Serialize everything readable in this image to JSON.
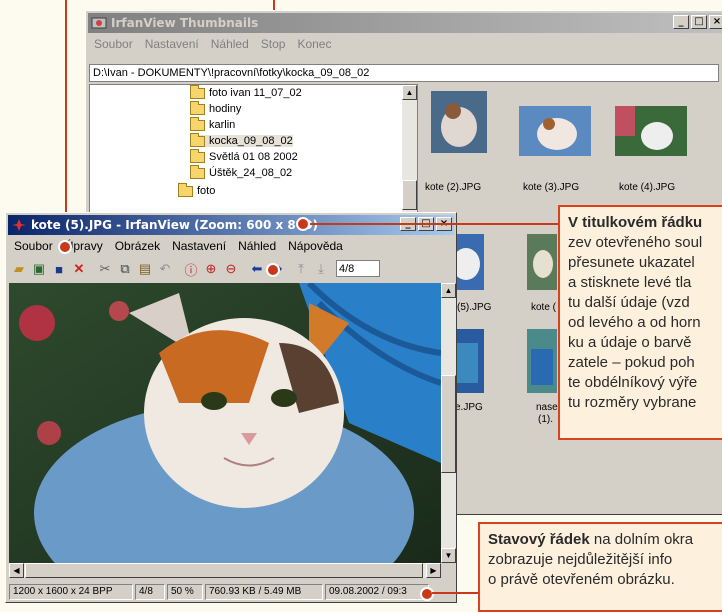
{
  "thumbnails_window": {
    "title": "IrfanView Thumbnails",
    "menu": [
      "Soubor",
      "Nastavení",
      "Náhled",
      "Stop",
      "Konec"
    ],
    "address": "D:\\Ivan - DOKUMENTY\\!pracovní\\fotky\\kocka_09_08_02",
    "tree": [
      "foto ivan 11_07_02",
      "hodiny",
      "karlin",
      "kocka_09_08_02",
      "Světlá 01 08 2002",
      "Úštěk_24_08_02",
      "foto"
    ],
    "thumb_labels": [
      "kote (2).JPG",
      "kote (3).JPG",
      "kote (4).JPG",
      "(5).JPG",
      "kote (",
      "e.JPG",
      "nase",
      "(1)."
    ]
  },
  "viewer_window": {
    "title": "kote (5).JPG - IrfanView (Zoom: 600 x 800)",
    "menu": [
      "Soubor",
      "Úpravy",
      "Obrázek",
      "Nastavení",
      "Náhled",
      "Nápověda"
    ],
    "page_box": "4/8",
    "status": [
      "1200 x 1600 x 24 BPP",
      "4/8",
      "50 %",
      "760.93 KB / 5.49 MB",
      "09.08.2002 / 09:3"
    ]
  },
  "callouts": {
    "title_bold": "V titulkovém řádku",
    "title_lines": [
      "zev otevřeného soul",
      "přesunete ukazatel",
      "a stisknete levé tla",
      "tu další údaje (vzd",
      "od levého a od horn",
      "ku a údaje o barvě",
      "zatele – pokud poh",
      "te obdélníkový výře",
      "tu rozměry vybrane"
    ],
    "status_bold": "Stavový řádek",
    "status_line1_rest": " na dolním okra",
    "status_lines": [
      "zobrazuje nejdůležitější info",
      "o právě otevřeném obrázku."
    ]
  },
  "colors": {
    "accent": "#c8381a",
    "callout_bg": "#fdf1de",
    "title_active": "#0a246a"
  }
}
